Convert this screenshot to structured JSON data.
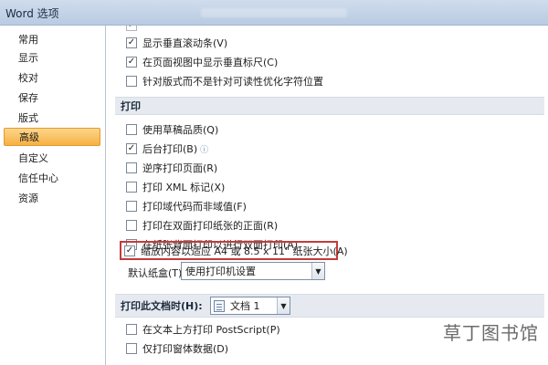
{
  "window": {
    "title": "Word 选项",
    "background_title": ""
  },
  "sidebar": {
    "items": [
      {
        "label": "常用"
      },
      {
        "label": "显示"
      },
      {
        "label": "校对"
      },
      {
        "label": "保存"
      },
      {
        "label": "版式"
      },
      {
        "label": "高级",
        "active": true
      },
      {
        "label": "自定义"
      },
      {
        "label": "信任中心"
      },
      {
        "label": "资源"
      }
    ]
  },
  "display_section": {
    "rows": [
      {
        "label": "显示垂直滚动条(V)",
        "checked": true
      },
      {
        "label": "在页面视图中显示垂直标尺(C)",
        "checked": true
      },
      {
        "label": "针对版式而不是针对可读性优化字符位置",
        "checked": false
      }
    ]
  },
  "print_section": {
    "header": "打印",
    "rows": [
      {
        "label": "使用草稿品质(Q)",
        "checked": false
      },
      {
        "label": "后台打印(B)",
        "checked": true,
        "info_icon": "info-icon"
      },
      {
        "label": "逆序打印页面(R)",
        "checked": false
      },
      {
        "label": "打印 XML 标记(X)",
        "checked": false
      },
      {
        "label": "打印域代码而非域值(F)",
        "checked": false
      },
      {
        "label": "打印在双面打印纸张的正面(R)",
        "checked": false
      },
      {
        "label": "在纸张背面打印以进行双面打印(A)",
        "checked": false
      },
      {
        "label": "缩放内容以适应 A4 或 8.5 x 11\" 纸张大小(A)",
        "checked": true
      }
    ],
    "default_tray_label": "默认纸盒(T):",
    "default_tray_value": "使用打印机设置"
  },
  "print_doc_section": {
    "header": "打印此文档时(H):",
    "doc_value": "文档 1",
    "rows": [
      {
        "label": "在文本上方打印 PostScript(P)",
        "checked": false
      },
      {
        "label": "仅打印窗体数据(D)",
        "checked": false
      }
    ]
  },
  "colors": {
    "highlight": "#c63a3a",
    "active_sidebar": "#f6b142"
  },
  "watermark": "草丁图书馆"
}
